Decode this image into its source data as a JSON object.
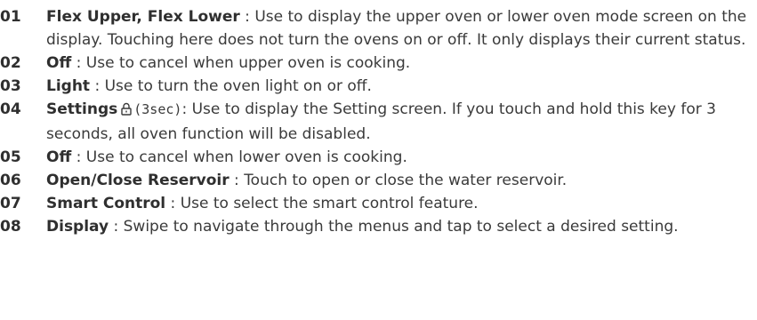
{
  "items": [
    {
      "num": "01",
      "term": "Flex Upper, Flex Lower",
      "sep": " : ",
      "desc": "Use to display the upper oven or lower oven mode screen on the display. Touching here does not turn the ovens on or off. It only displays their current status."
    },
    {
      "num": "02",
      "term": "Off",
      "sep": " : ",
      "desc": "Use to cancel when upper oven is cooking."
    },
    {
      "num": "03",
      "term": "Light",
      "sep": " : ",
      "desc": "Use to turn the oven light on or off."
    },
    {
      "num": "04",
      "term": "Settings",
      "lock_icon": "lock-icon",
      "lock_label": "(3sec)",
      "sep": ": ",
      "desc": "Use to display the Setting screen. If you touch and hold this key for 3 seconds, all oven function will be disabled."
    },
    {
      "num": "05",
      "term": "Off",
      "sep": " : ",
      "desc": "Use to cancel when lower oven is cooking."
    },
    {
      "num": "06",
      "term": "Open/Close Reservoir",
      "sep": " : ",
      "desc": "Touch to open or close the water reservoir."
    },
    {
      "num": "07",
      "term": "Smart Control",
      "sep": " : ",
      "desc": "Use to select the smart control feature."
    },
    {
      "num": "08",
      "term": "Display",
      "sep": " : ",
      "desc": "Swipe to navigate through the menus and tap to select a desired setting."
    }
  ]
}
